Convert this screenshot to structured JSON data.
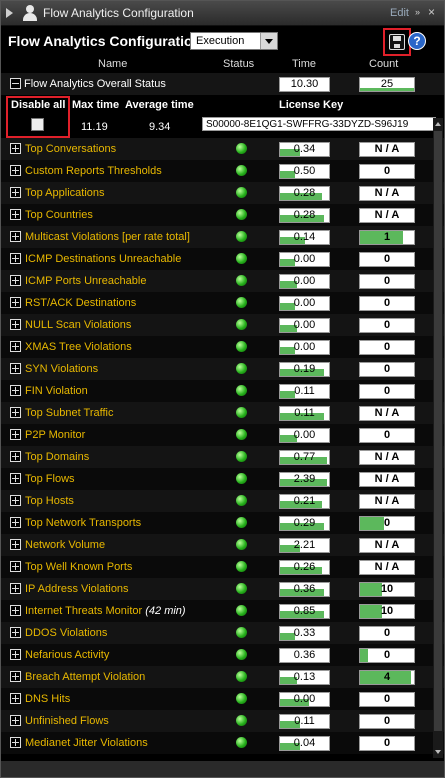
{
  "window": {
    "title": "Flow Analytics Configuration",
    "edit_label": "Edit",
    "chevron": "»",
    "close": "×"
  },
  "header": {
    "title": "Flow Analytics Configuration",
    "mode_select": "Execution",
    "help_label": "?"
  },
  "columns": {
    "name": "Name",
    "status": "Status",
    "time": "Time",
    "count": "Count"
  },
  "overall": {
    "label": "Flow Analytics Overall Status",
    "time": "10.30",
    "count": "25"
  },
  "summary": {
    "disable_all": "Disable all",
    "max_time_label": "Max time",
    "avg_time_label": "Average time",
    "license_label": "License Key",
    "max_time": "11.19",
    "avg_time": "9.34",
    "license_key": "S00000-8E1QG1-SWFFRG-33DYZD-S96J19"
  },
  "colors": {
    "label_yellow": "#e8b800",
    "status_green": "#27b11c",
    "bar_green": "#5cb85c",
    "highlight_red": "#e0202a"
  },
  "rows": [
    {
      "name": "Top Conversations",
      "time": "0.34",
      "count": "N / A",
      "tfill": 0.4,
      "cfill": 0
    },
    {
      "name": "Custom Reports Thresholds",
      "time": "0.50",
      "count": "0",
      "tfill": 0.3,
      "cfill": 0
    },
    {
      "name": "Top Applications",
      "time": "0.28",
      "count": "N / A",
      "tfill": 0.85,
      "cfill": 0
    },
    {
      "name": "Top Countries",
      "time": "0.28",
      "count": "N / A",
      "tfill": 0.9,
      "cfill": 0
    },
    {
      "name": "Multicast Violations [per rate total]",
      "time": "0.14",
      "count": "1",
      "tfill": 0.5,
      "cfill": 0.8
    },
    {
      "name": "ICMP Destinations Unreachable",
      "time": "0.00",
      "count": "0",
      "tfill": 0.3,
      "cfill": 0
    },
    {
      "name": "ICMP Ports Unreachable",
      "time": "0.00",
      "count": "0",
      "tfill": 0.35,
      "cfill": 0
    },
    {
      "name": "RST/ACK Destinations",
      "time": "0.00",
      "count": "0",
      "tfill": 0.3,
      "cfill": 0
    },
    {
      "name": "NULL Scan Violations",
      "time": "0.00",
      "count": "0",
      "tfill": 0.35,
      "cfill": 0
    },
    {
      "name": "XMAS Tree Violations",
      "time": "0.00",
      "count": "0",
      "tfill": 0.3,
      "cfill": 0
    },
    {
      "name": "SYN Violations",
      "time": "0.19",
      "count": "0",
      "tfill": 0.9,
      "cfill": 0
    },
    {
      "name": "FIN Violation",
      "time": "0.11",
      "count": "0",
      "tfill": 0.3,
      "cfill": 0
    },
    {
      "name": "Top Subnet Traffic",
      "time": "0.11",
      "count": "N / A",
      "tfill": 0.9,
      "cfill": 0
    },
    {
      "name": "P2P Monitor",
      "time": "0.00",
      "count": "0",
      "tfill": 0.35,
      "cfill": 0
    },
    {
      "name": "Top Domains",
      "time": "0.77",
      "count": "N / A",
      "tfill": 0.95,
      "cfill": 0
    },
    {
      "name": "Top Flows",
      "time": "2.39",
      "count": "N / A",
      "tfill": 0.95,
      "cfill": 0
    },
    {
      "name": "Top Hosts",
      "time": "0.21",
      "count": "N / A",
      "tfill": 0.85,
      "cfill": 0
    },
    {
      "name": "Top Network Transports",
      "time": "0.29",
      "count": "0",
      "tfill": 0.9,
      "cfill": 0.45
    },
    {
      "name": "Network Volume",
      "time": "2.21",
      "count": "N / A",
      "tfill": 0.4,
      "cfill": 0
    },
    {
      "name": "Top Well Known Ports",
      "time": "0.26",
      "count": "N / A",
      "tfill": 0.85,
      "cfill": 0
    },
    {
      "name": "IP Address Violations",
      "time": "0.36",
      "count": "10",
      "tfill": 0.9,
      "cfill": 0.4
    },
    {
      "name": "Internet Threats Monitor",
      "note": "(42 min)",
      "time": "0.85",
      "count": "10",
      "tfill": 0.9,
      "cfill": 0.4
    },
    {
      "name": "DDOS Violations",
      "time": "0.33",
      "count": "0",
      "tfill": 0.3,
      "cfill": 0
    },
    {
      "name": "Nefarious Activity",
      "time": "0.36",
      "count": "0",
      "tfill": 0,
      "cfill": 0.15
    },
    {
      "name": "Breach Attempt Violation",
      "time": "0.13",
      "count": "4",
      "tfill": 0.35,
      "cfill": 0.95
    },
    {
      "name": "DNS Hits",
      "time": "0.00",
      "count": "0",
      "tfill": 0.6,
      "cfill": 0
    },
    {
      "name": "Unfinished Flows",
      "time": "0.11",
      "count": "0",
      "tfill": 0.4,
      "cfill": 0
    },
    {
      "name": "Medianet Jitter Violations",
      "time": "0.04",
      "count": "0",
      "tfill": 0.4,
      "cfill": 0
    }
  ]
}
